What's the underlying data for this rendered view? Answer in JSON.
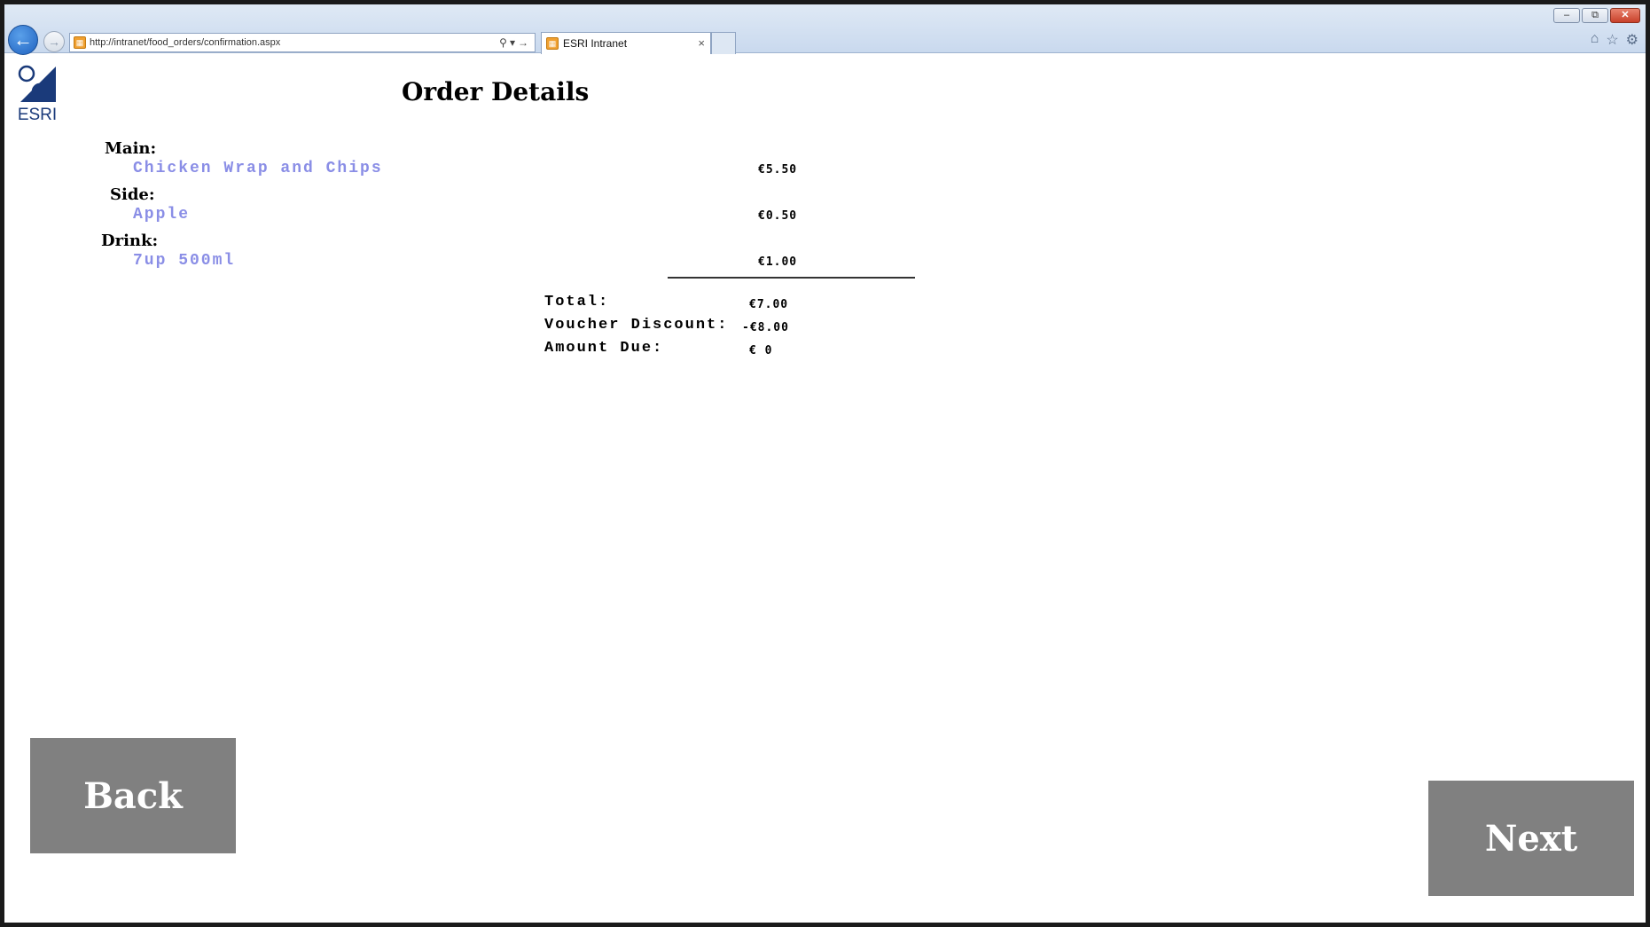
{
  "browser": {
    "url": "http://intranet/food_orders/confirmation.aspx",
    "tab_title": "ESRI Intranet",
    "tab_close": "×",
    "window_controls": [
      "minimize",
      "restore",
      "close"
    ],
    "toolbar_icons": [
      "home-icon",
      "star-icon",
      "gear-icon"
    ]
  },
  "logo": {
    "text": "ESRI"
  },
  "page": {
    "title": "Order Details"
  },
  "order": {
    "main": {
      "label": "Main:",
      "item": "Chicken Wrap and Chips",
      "price": "€5.50"
    },
    "side": {
      "label": "Side:",
      "item": "Apple",
      "price": "€0.50"
    },
    "drink": {
      "label": "Drink:",
      "item": "7up 500ml",
      "price": "€1.00"
    }
  },
  "summary": {
    "total_label": "Total:",
    "total_value": "€7.00",
    "discount_label": "Voucher Discount:",
    "discount_value": "-€8.00",
    "due_label": "Amount Due:",
    "due_value": "€ 0"
  },
  "buttons": {
    "back": "Back",
    "next": "Next"
  },
  "colors": {
    "item_text": "#8a8ee6",
    "button_bg": "#808080",
    "logo_blue": "#1a3a7a"
  }
}
